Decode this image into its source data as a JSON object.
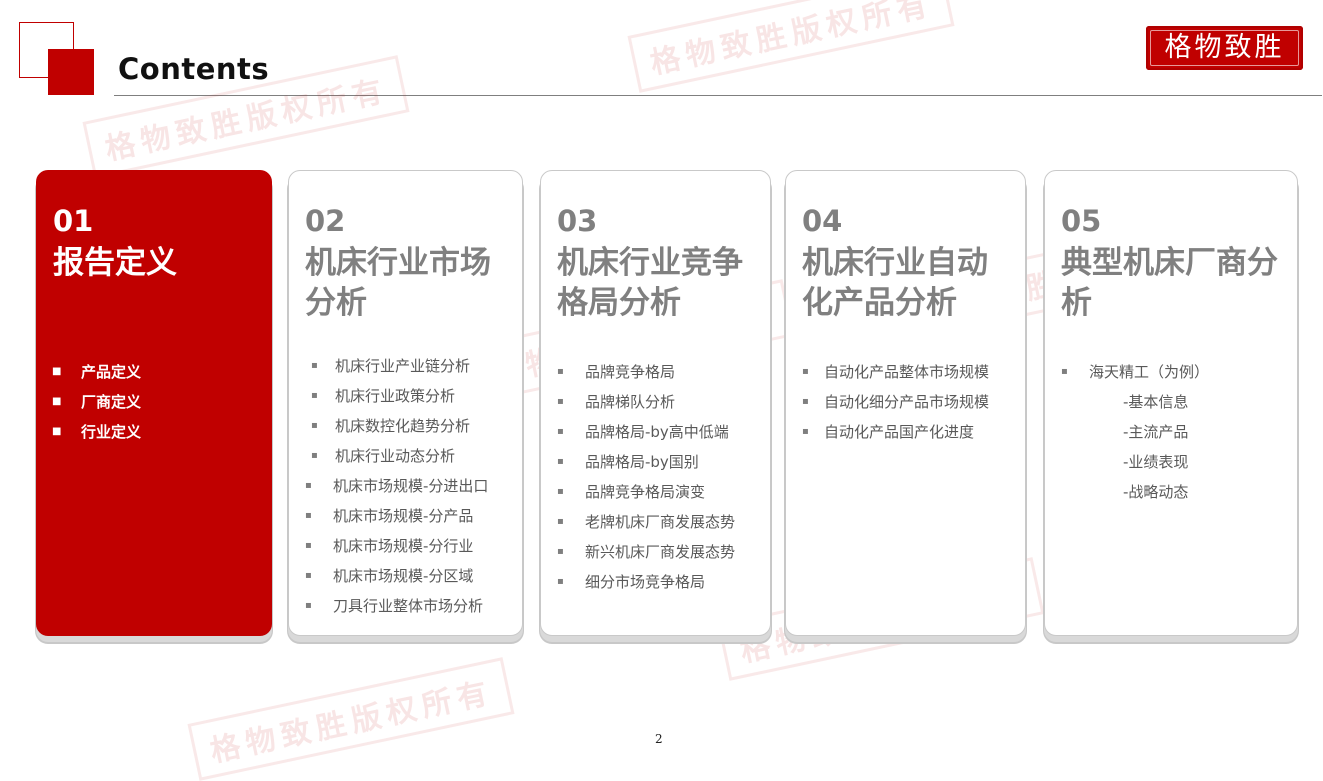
{
  "header": {
    "title": "Contents",
    "seal_text": "格物致胜"
  },
  "watermark_text": "格物致胜版权所有",
  "colors": {
    "accent": "#c00000",
    "muted": "#808080"
  },
  "cards": [
    {
      "num": "01",
      "title": "报告定义",
      "active": true,
      "items": [
        "产品定义",
        "厂商定义",
        "行业定义"
      ]
    },
    {
      "num": "02",
      "title": "机床行业市场分析",
      "active": false,
      "items": [
        "机床行业产业链分析",
        "机床行业政策分析",
        "机床数控化趋势分析",
        "机床行业动态分析",
        "机床市场规模-分进出口",
        "机床市场规模-分产品",
        "机床市场规模-分行业",
        "机床市场规模-分区域",
        "刀具行业整体市场分析"
      ]
    },
    {
      "num": "03",
      "title": "机床行业竞争格局分析",
      "active": false,
      "items": [
        "品牌竞争格局",
        "品牌梯队分析",
        "品牌格局-by高中低端",
        "品牌格局-by国别",
        "品牌竞争格局演变",
        "老牌机床厂商发展态势",
        "新兴机床厂商发展态势",
        "细分市场竞争格局"
      ]
    },
    {
      "num": "04",
      "title": "机床行业自动化产品分析",
      "active": false,
      "items": [
        "自动化产品整体市场规模",
        "自动化细分产品市场规模",
        "自动化产品国产化进度"
      ]
    },
    {
      "num": "05",
      "title": "典型机床厂商分析",
      "active": false,
      "items": [
        "海天精工（为例）",
        "-基本信息",
        "-主流产品",
        "-业绩表现",
        "-战略动态"
      ]
    }
  ],
  "page_number": "2"
}
